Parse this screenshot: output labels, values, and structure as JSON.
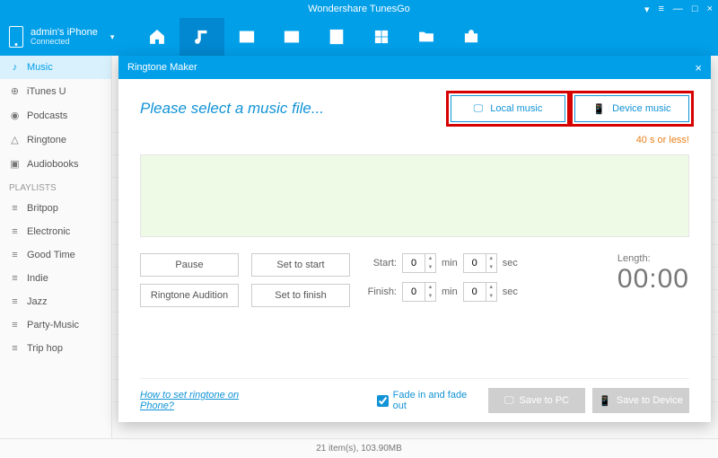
{
  "app": {
    "title": "Wondershare TunesGo"
  },
  "window": {
    "user": "▾",
    "menu": "≡",
    "min": "—",
    "max": "□",
    "close": "×"
  },
  "device": {
    "name": "admin's iPhone",
    "status": "Connected",
    "chevron": "▾"
  },
  "sidebar": {
    "section1": [
      {
        "label": "Music",
        "icon": "♪",
        "key": "music"
      },
      {
        "label": "iTunes U",
        "icon": "⊕",
        "key": "itunesu"
      },
      {
        "label": "Podcasts",
        "icon": "◉",
        "key": "podcasts"
      },
      {
        "label": "Ringtone",
        "icon": "△",
        "key": "ringtone"
      },
      {
        "label": "Audiobooks",
        "icon": "▣",
        "key": "audiobooks"
      }
    ],
    "playlists_hdr": "PLAYLISTS",
    "playlists": [
      {
        "label": "Britpop"
      },
      {
        "label": "Electronic"
      },
      {
        "label": "Good Time"
      },
      {
        "label": "Indie"
      },
      {
        "label": "Jazz"
      },
      {
        "label": "Party-Music"
      },
      {
        "label": "Trip hop"
      }
    ],
    "plicon": "≡"
  },
  "modal": {
    "title": "Ringtone Maker",
    "prompt": "Please select a music file...",
    "local_btn": "Local music",
    "device_btn": "Device music",
    "limit": "40 s or less!",
    "pause": "Pause",
    "audition": "Ringtone Audition",
    "set_start": "Set to start",
    "set_finish": "Set to finish",
    "start_lbl": "Start:",
    "finish_lbl": "Finish:",
    "min_lbl": "min",
    "sec_lbl": "sec",
    "zero": "0",
    "length_lbl": "Length:",
    "length_val": "00:00",
    "help": "How to set ringtone on Phone?",
    "fade": "Fade in and fade out",
    "save_pc": "Save to PC",
    "save_dev": "Save to Device"
  },
  "status": {
    "text": "21 item(s), 103.90MB"
  }
}
